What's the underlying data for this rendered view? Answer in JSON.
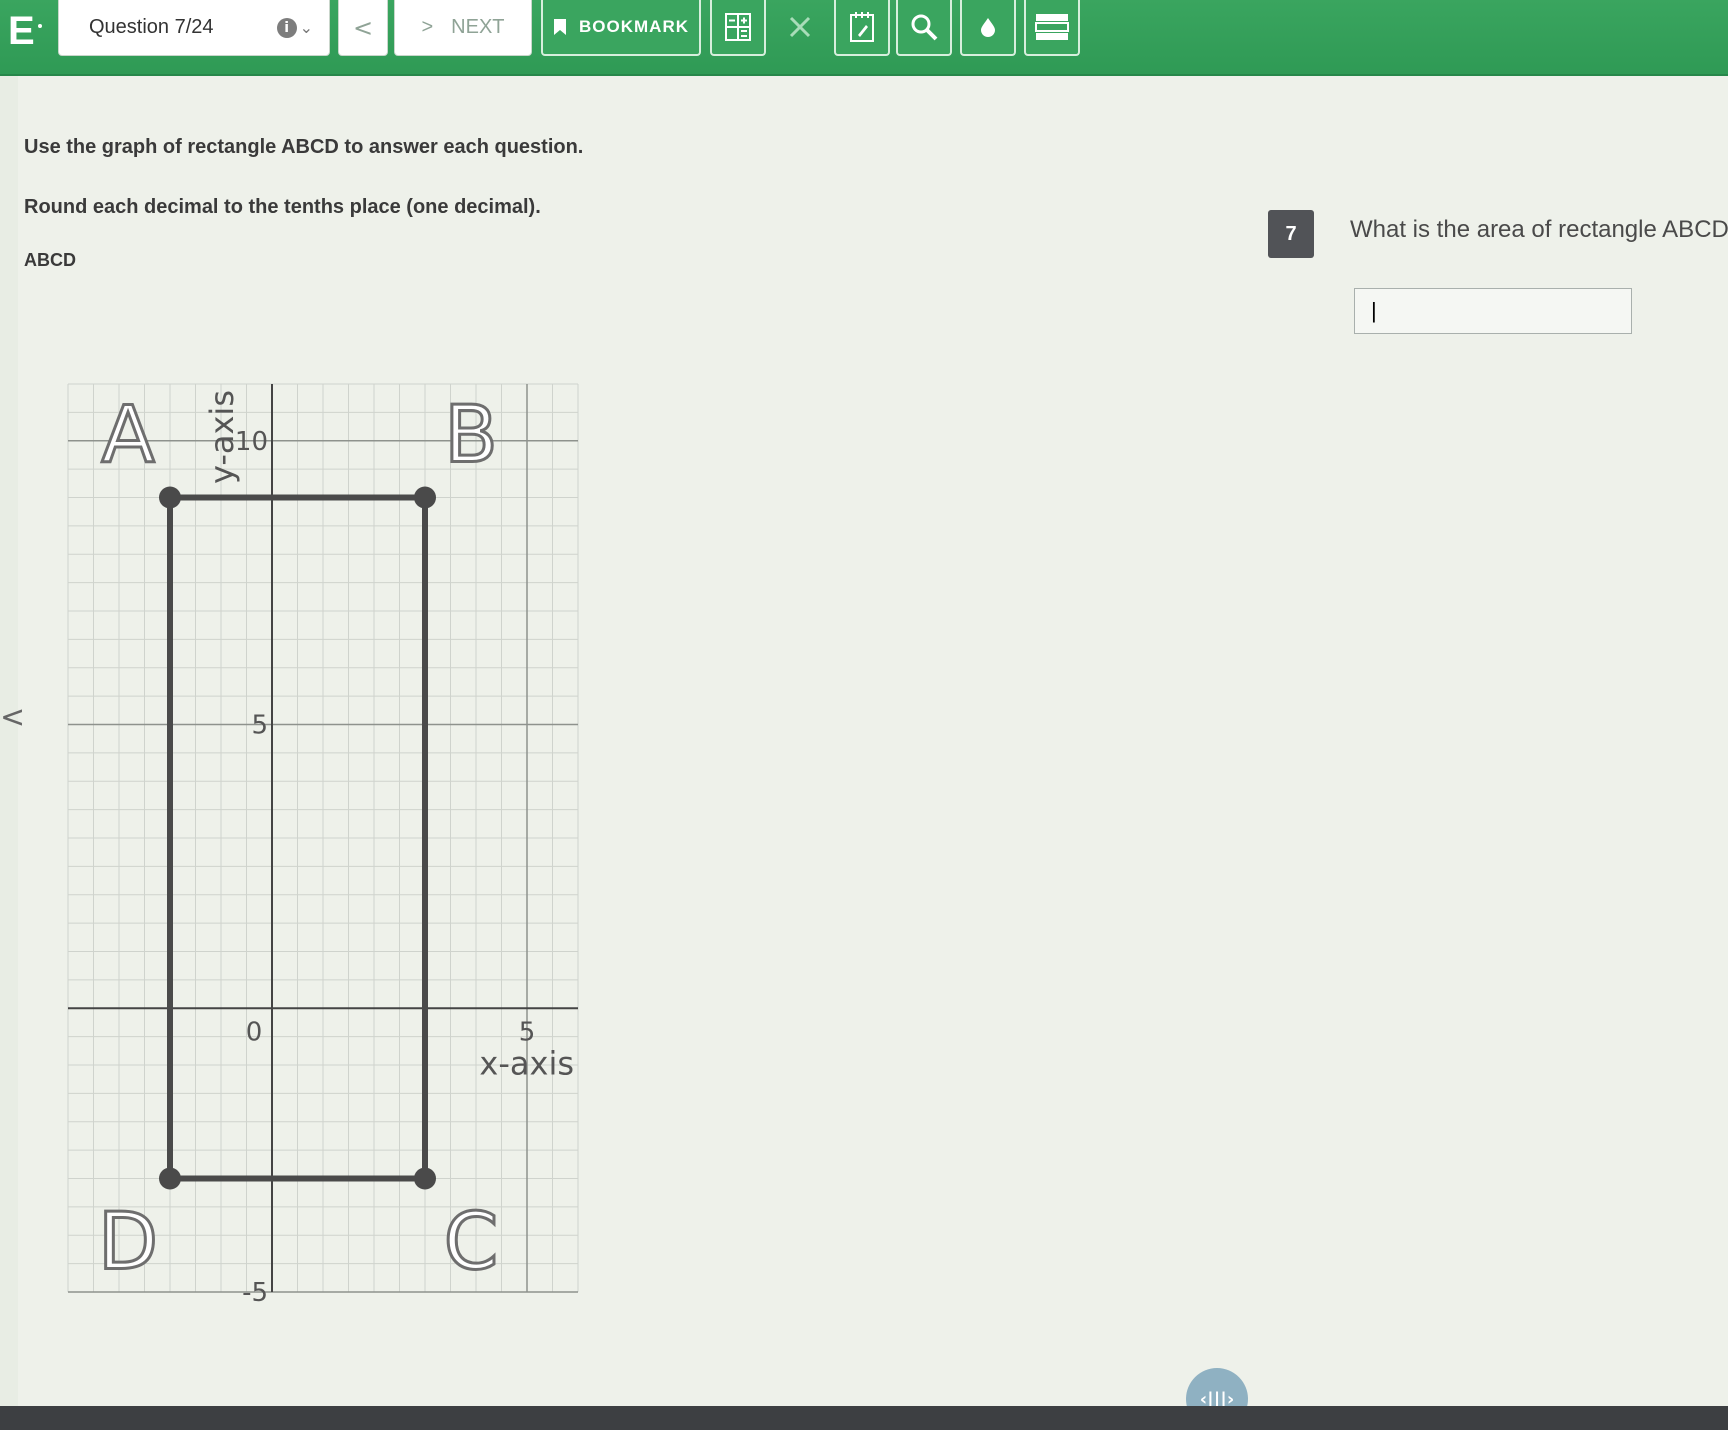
{
  "toolbar": {
    "logo": "E",
    "question_label": "Question 7/24",
    "info_glyph": "i",
    "dropdown_glyph": "⌄",
    "prev_glyph": "<",
    "next_glyph": ">",
    "next_label": "NEXT",
    "bookmark_label": "BOOKMARK",
    "tools": [
      "calculator-icon",
      "eliminator-icon",
      "notepad-icon",
      "magnifier-icon",
      "highlighter-icon",
      "line-reader-icon"
    ]
  },
  "passage": {
    "line1": "Use the graph of rectangle ABCD to answer each question.",
    "line2": "Round each decimal to the tenths place (one decimal).",
    "figure_caption": "ABCD"
  },
  "chart_data": {
    "type": "scatter",
    "title": "ABCD",
    "xlabel": "x-axis",
    "ylabel": "y-axis",
    "xlim": [
      -4,
      6
    ],
    "ylim": [
      -5,
      11
    ],
    "x_ticks": [
      {
        "value": 0,
        "label": "0"
      },
      {
        "value": 5,
        "label": "5"
      }
    ],
    "y_ticks": [
      {
        "value": 10,
        "label": "10"
      },
      {
        "value": 5,
        "label": "5"
      },
      {
        "value": -5,
        "label": "-5"
      }
    ],
    "grid": true,
    "points": [
      {
        "name": "A",
        "x": -2,
        "y": 9
      },
      {
        "name": "B",
        "x": 3,
        "y": 9
      },
      {
        "name": "C",
        "x": 3,
        "y": -3
      },
      {
        "name": "D",
        "x": -2,
        "y": -3
      }
    ]
  },
  "question": {
    "number": "7",
    "text": "What is the area of rectangle ABCD?",
    "answer_value": "|"
  },
  "nav": {
    "side_arrow": "<",
    "pager_label": "‹|||›"
  },
  "colors": {
    "toolbar_green": "#3aa55f",
    "number_badge": "#515357",
    "rectangle_stroke": "#4a4a4a"
  }
}
